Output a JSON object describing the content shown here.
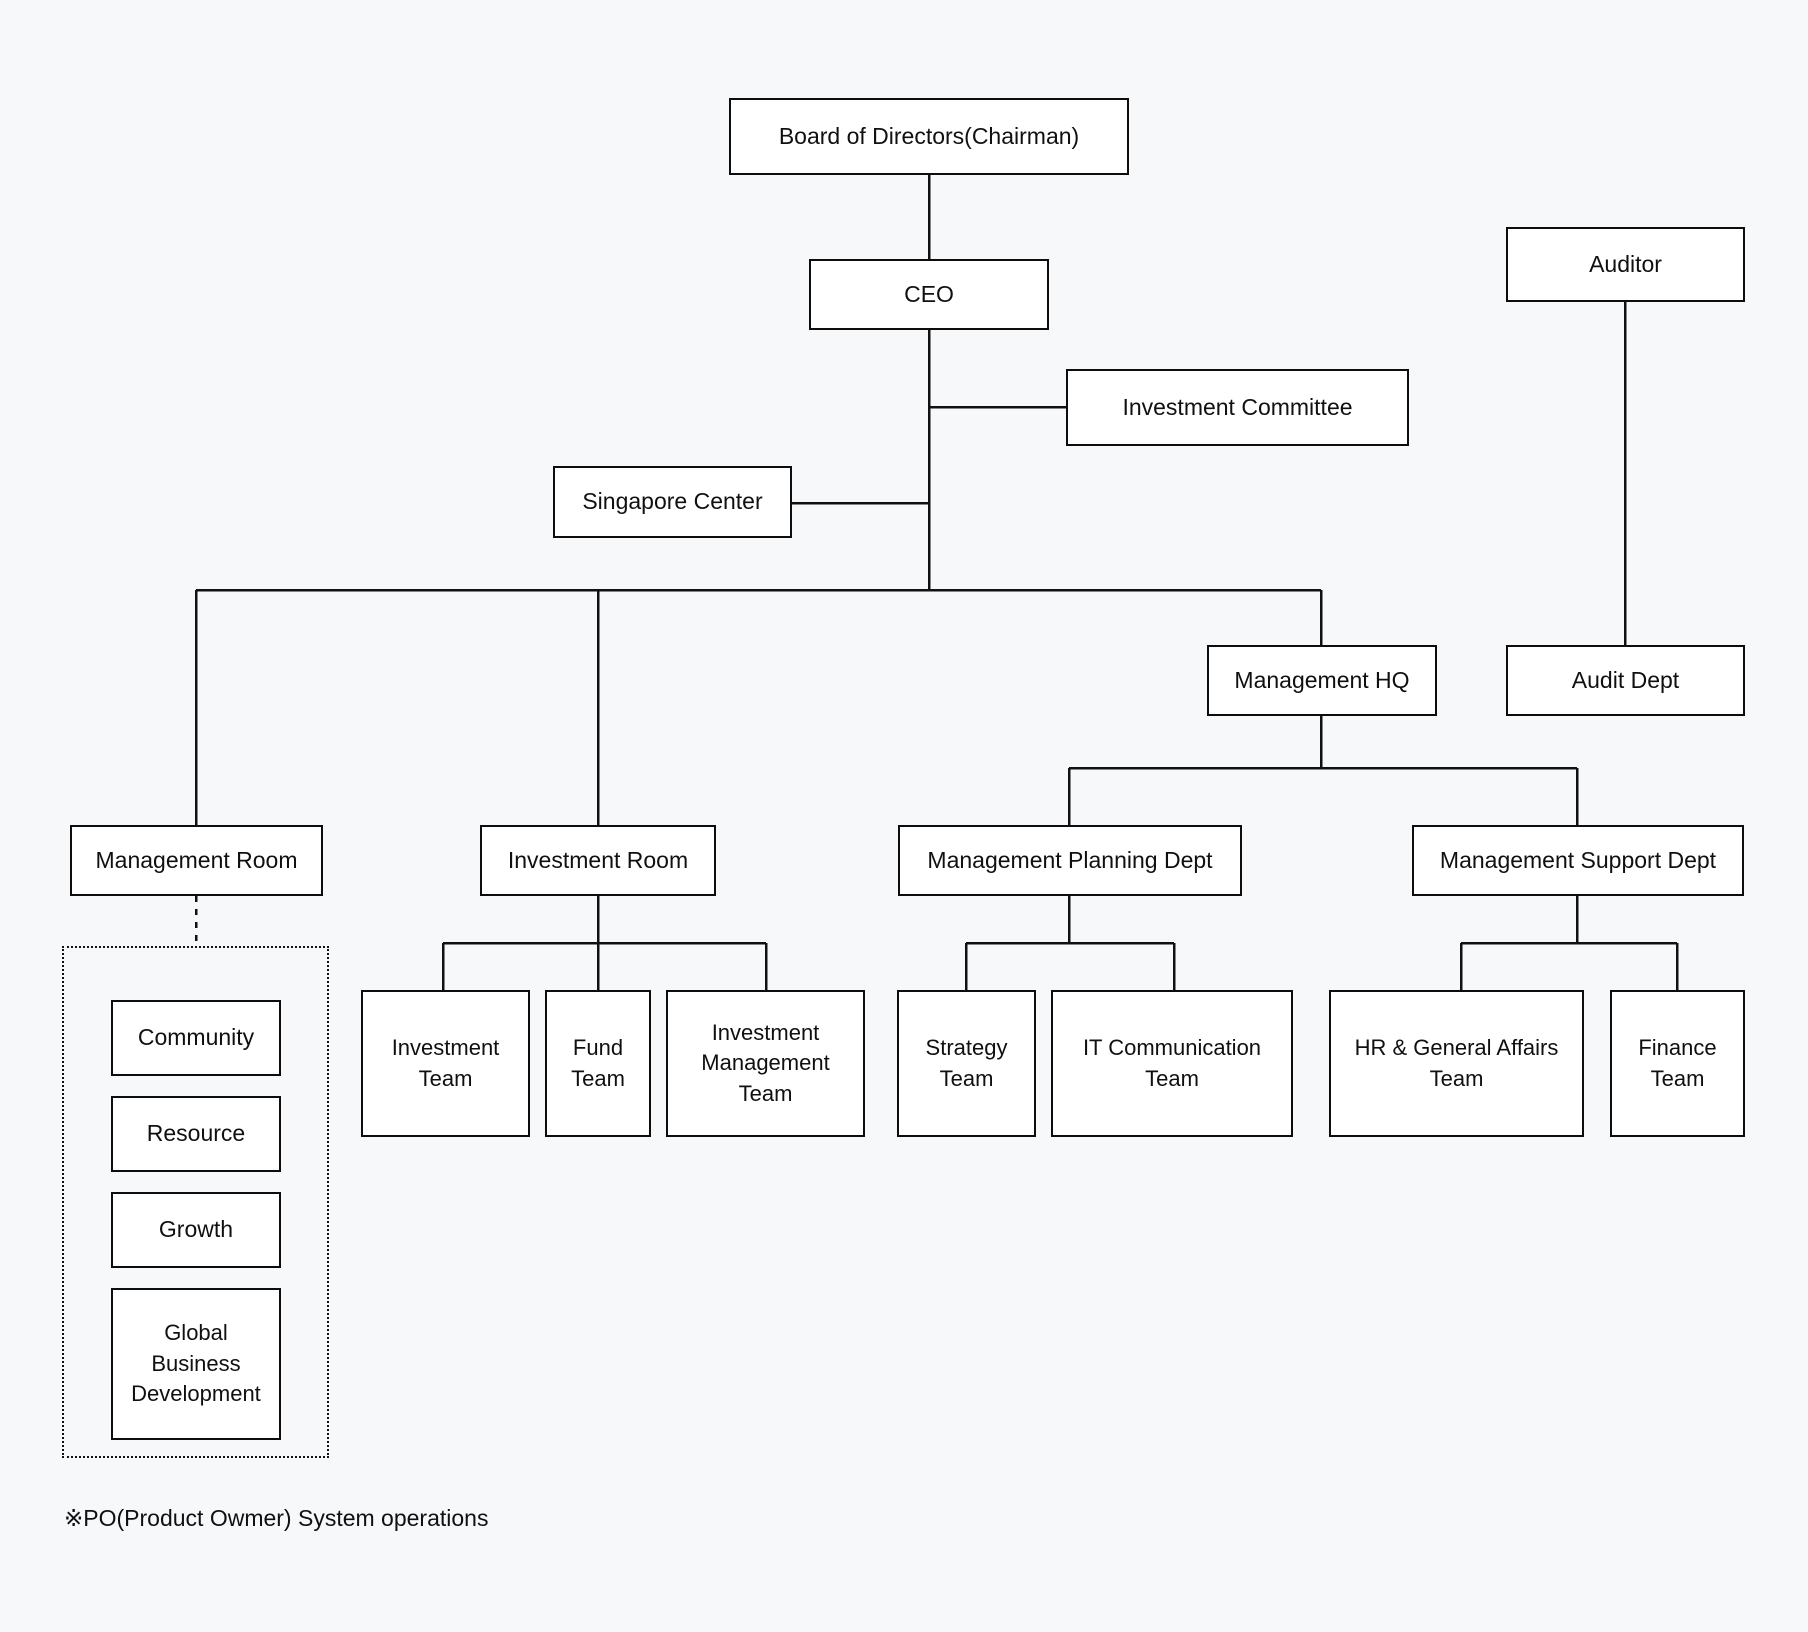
{
  "diagram": {
    "title": "Organization Chart",
    "background_color": "#f6f8fa",
    "node_fill": "#ffffff",
    "node_stroke": "#0d0d0d",
    "connector_color": "#111111"
  },
  "nodes": {
    "board": {
      "label": "Board of Directors(Chairman)"
    },
    "ceo": {
      "label": "CEO"
    },
    "investment_committee": {
      "label": "Investment Committee"
    },
    "singapore_center": {
      "label": "Singapore Center"
    },
    "auditor": {
      "label": "Auditor"
    },
    "audit_dept": {
      "label": "Audit Dept"
    },
    "management_hq": {
      "label": "Management HQ"
    },
    "management_room": {
      "label": "Management Room"
    },
    "investment_room": {
      "label": "Investment Room"
    },
    "management_planning_dept": {
      "label": "Management Planning Dept"
    },
    "management_support_dept": {
      "label": "Management Support Dept"
    },
    "investment_team": {
      "label": "Investment\nTeam"
    },
    "fund_team": {
      "label": "Fund\nTeam"
    },
    "investment_management_team": {
      "label": "Investment\nManagement\nTeam"
    },
    "strategy_team": {
      "label": "Strategy\nTeam"
    },
    "it_communication_team": {
      "label": "IT Communication\nTeam"
    },
    "hr_general_affairs_team": {
      "label": "HR & General Affairs\nTeam"
    },
    "finance_team": {
      "label": "Finance\nTeam"
    },
    "community": {
      "label": "Community"
    },
    "resource": {
      "label": "Resource"
    },
    "growth": {
      "label": "Growth"
    },
    "global_business_development": {
      "label": "Global\nBusiness\nDevelopment"
    }
  },
  "footnote": {
    "text": "※PO(Product Owmer) System operations"
  },
  "hierarchy": [
    {
      "parent": "board",
      "child": "ceo"
    },
    {
      "parent": "ceo",
      "child": "investment_committee"
    },
    {
      "parent": "ceo",
      "child": "singapore_center"
    },
    {
      "parent": "ceo",
      "child": "management_room"
    },
    {
      "parent": "ceo",
      "child": "investment_room"
    },
    {
      "parent": "ceo",
      "child": "management_hq"
    },
    {
      "parent": "auditor",
      "child": "audit_dept"
    },
    {
      "parent": "management_hq",
      "child": "management_planning_dept"
    },
    {
      "parent": "management_hq",
      "child": "management_support_dept"
    },
    {
      "parent": "investment_room",
      "child": "investment_team"
    },
    {
      "parent": "investment_room",
      "child": "fund_team"
    },
    {
      "parent": "investment_room",
      "child": "investment_management_team"
    },
    {
      "parent": "management_planning_dept",
      "child": "strategy_team"
    },
    {
      "parent": "management_planning_dept",
      "child": "it_communication_team"
    },
    {
      "parent": "management_support_dept",
      "child": "hr_general_affairs_team"
    },
    {
      "parent": "management_support_dept",
      "child": "finance_team"
    },
    {
      "parent": "management_room",
      "child": "po_group",
      "style": "dashed"
    }
  ]
}
